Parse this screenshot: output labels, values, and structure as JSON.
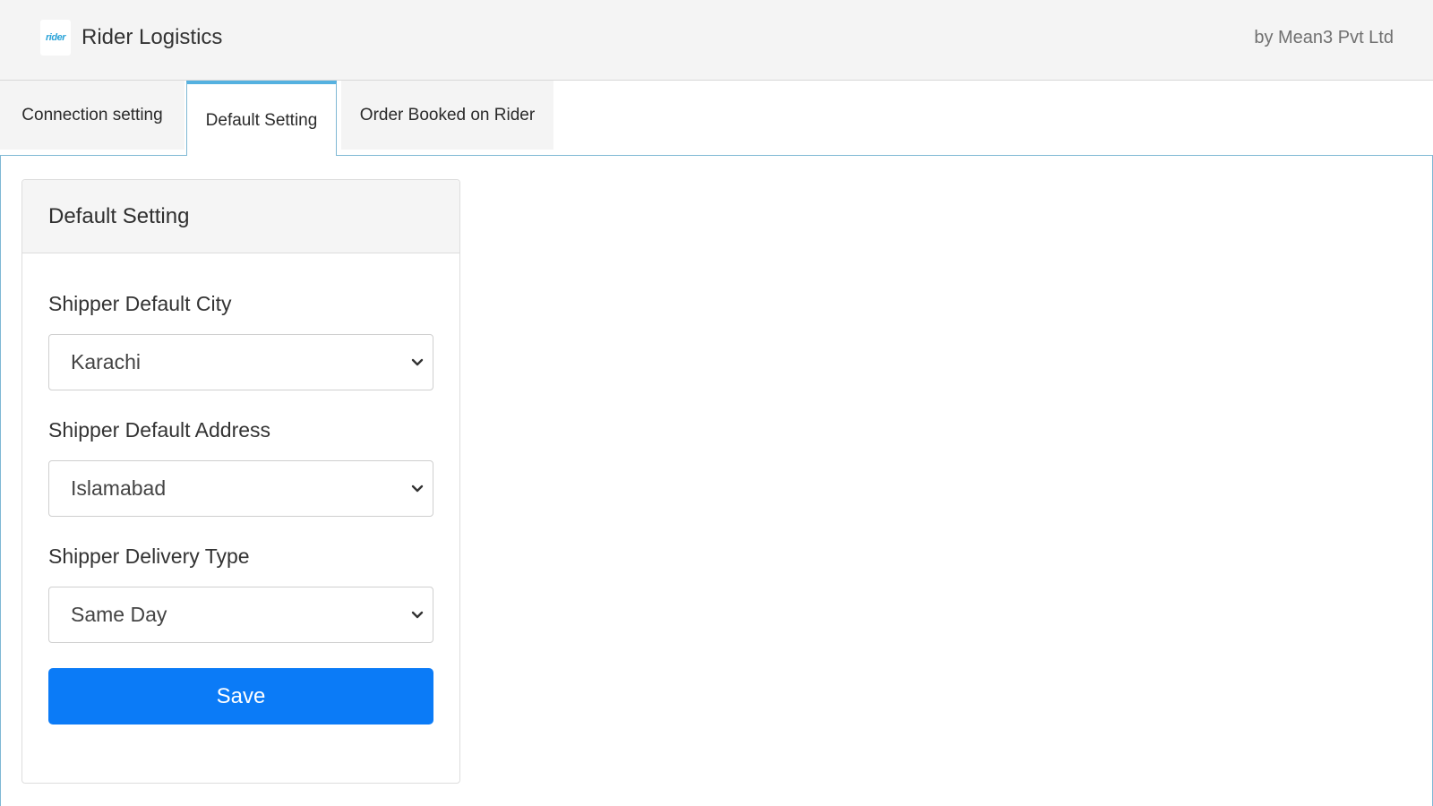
{
  "header": {
    "logo_text": "rider",
    "title": "Rider Logistics",
    "vendor": "by Mean3 Pvt Ltd"
  },
  "tabs": [
    {
      "label": "Connection setting",
      "active": false
    },
    {
      "label": "Default Setting",
      "active": true
    },
    {
      "label": "Order Booked on Rider",
      "active": false
    }
  ],
  "card": {
    "title": "Default Setting",
    "fields": [
      {
        "label": "Shipper Default City",
        "value": "Karachi",
        "icon": "chevron-down-icon"
      },
      {
        "label": "Shipper Default Address",
        "value": "Islamabad",
        "icon": "chevron-down-icon"
      },
      {
        "label": "Shipper Delivery Type",
        "value": "Same Day",
        "icon": "chevron-down-icon"
      }
    ],
    "save_label": "Save"
  },
  "colors": {
    "accent": "#0b7bf7",
    "tab_active_border": "#55b1e0",
    "header_bg": "#f4f4f4"
  }
}
